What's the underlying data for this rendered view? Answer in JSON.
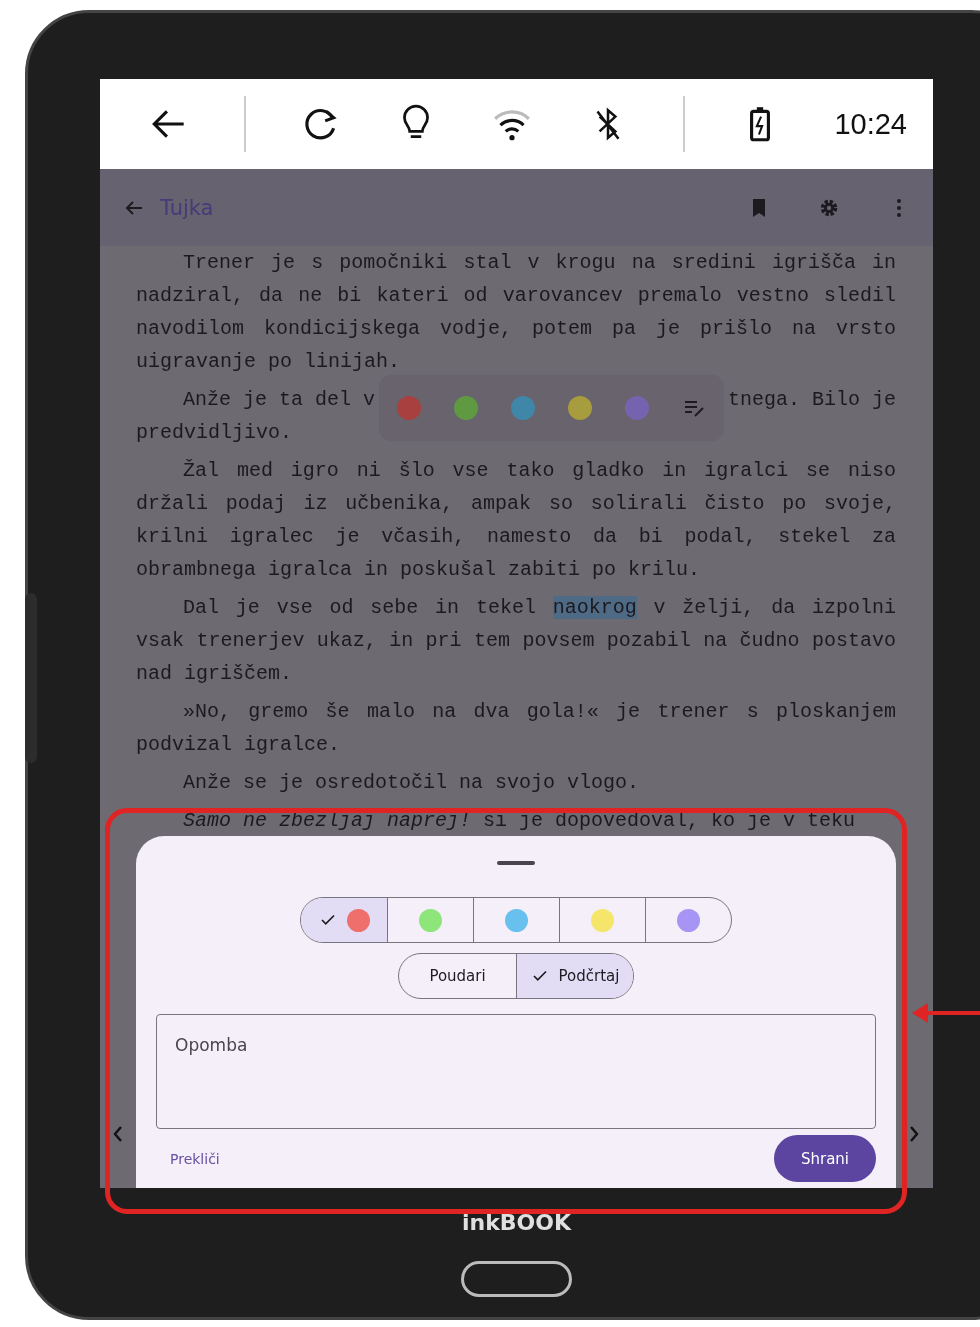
{
  "status_bar": {
    "time": "10:24"
  },
  "app_bar": {
    "title": "Tujka"
  },
  "paragraphs": [
    {
      "kind": "plain",
      "text": "Trener je s pomočniki stal v krogu na sredini igrišča in nadziral, da ne bi kateri od varovancev premalo vestno sledil navodilom kondicijskega vodje, potem pa je prišlo na vrsto uigravanje po linijah."
    },
    {
      "kind": "popup",
      "before": "Anže je ta del v",
      "after": "tnega. Bilo je",
      "text": "predvidljivo."
    },
    {
      "kind": "plain",
      "text": "Žal med igro ni šlo vse tako gladko in igralci se niso držali podaj iz učbenika, ampak so solirali čisto po svoje, krilni igralec je včasih, namesto da bi podal, stekel za obrambnega igralca in poskušal zabiti po krilu."
    },
    {
      "kind": "highlight",
      "before": "Dal je vse od sebe in tekel ",
      "highlight": "naokrog",
      "text": " v želji, da izpolni vsak trenerjev ukaz, in pri tem povsem pozabil na čudno postavo nad igriščem."
    },
    {
      "kind": "plain",
      "text": "»No, gremo še malo na dva gola!« je trener s ploskanjem podvizal igralce."
    },
    {
      "kind": "plain",
      "text": "Anže se je osredotočil na svojo vlogo."
    },
    {
      "kind": "plain",
      "text": "*Samo ne zbezljaj naprej!* si je dopovedoval, ko je v teku"
    }
  ],
  "quick_toolbar": {
    "colors": [
      {
        "color": "#a8403f"
      },
      {
        "color": "#5f9a42"
      },
      {
        "color": "#3f86a8"
      },
      {
        "color": "#a79c3e"
      },
      {
        "color": "#7563b0"
      }
    ]
  },
  "sheet": {
    "colors": [
      {
        "color": "#ef6f6c",
        "selected": true
      },
      {
        "color": "#8ee67a",
        "selected": false
      },
      {
        "color": "#67c0ee",
        "selected": false
      },
      {
        "color": "#f5e66b",
        "selected": false
      },
      {
        "color": "#a795f5",
        "selected": false
      }
    ],
    "styles": [
      {
        "label": "Poudari",
        "selected": false
      },
      {
        "label": "Podčrtaj",
        "selected": true
      }
    ],
    "note": {
      "placeholder": "Opomba"
    },
    "cancel": "Prekliči",
    "save": "Shrani"
  },
  "brand": "inkBOOK"
}
